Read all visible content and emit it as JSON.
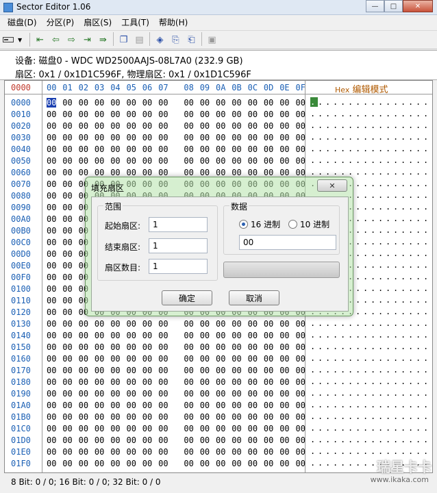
{
  "window": {
    "title": "Sector Editor 1.06",
    "buttons": {
      "minimize": "—",
      "maximize": "□",
      "close": "✕"
    }
  },
  "menu": [
    "磁盘(D)",
    "分区(P)",
    "扇区(S)",
    "工具(T)",
    "帮助(H)"
  ],
  "toolbar": {
    "disk_combo_arrow": "▼",
    "buttons": [
      {
        "name": "first-sector-icon",
        "glyph": "⇤",
        "tone": "green"
      },
      {
        "name": "prev-sector-icon",
        "glyph": "⇦",
        "tone": "green"
      },
      {
        "name": "next-sector-icon",
        "glyph": "⇨",
        "tone": "green"
      },
      {
        "name": "last-sector-icon",
        "glyph": "⇥",
        "tone": "green"
      },
      {
        "name": "goto-sector-icon",
        "glyph": "⇛",
        "tone": "green"
      },
      {
        "name": "copy-icon",
        "glyph": "❐",
        "tone": "blue"
      },
      {
        "name": "paste-icon",
        "glyph": "▤",
        "tone": "gray"
      },
      {
        "name": "fill-icon",
        "glyph": "◈",
        "tone": "blue"
      },
      {
        "name": "export-icon",
        "glyph": "⎘",
        "tone": "blue"
      },
      {
        "name": "import-icon",
        "glyph": "⎗",
        "tone": "blue"
      },
      {
        "name": "save-icon",
        "glyph": "▣",
        "tone": "gray"
      }
    ]
  },
  "info": {
    "device": "设备: 磁盘0 - WDC WD2500AAJS-08L7A0 (232.9 GB)",
    "sector": "扇区: 0x1 / 0x1D1C596F, 物理扇区: 0x1 / 0x1D1C596F"
  },
  "hex": {
    "offset_header": "0000",
    "columns": [
      "00",
      "01",
      "02",
      "03",
      "04",
      "05",
      "06",
      "07",
      "08",
      "09",
      "0A",
      "0B",
      "0C",
      "0D",
      "0E",
      "0F"
    ],
    "mode_prefix": "Hex",
    "mode_label": "编辑模式",
    "rows": [
      "0000",
      "0010",
      "0020",
      "0030",
      "0040",
      "0050",
      "0060",
      "0070",
      "0080",
      "0090",
      "00A0",
      "00B0",
      "00C0",
      "00D0",
      "00E0",
      "00F0",
      "0100",
      "0110",
      "0120",
      "0130",
      "0140",
      "0150",
      "0160",
      "0170",
      "0180",
      "0190",
      "01A0",
      "01B0",
      "01C0",
      "01D0",
      "01E0",
      "01F0"
    ],
    "byte_value": "00",
    "ascii_dot": "."
  },
  "status": "8 Bit: 0 / 0;  16 Bit: 0 / 0;  32 Bit: 0 / 0",
  "watermark": {
    "main": "瑞星卡卡",
    "sub": "www.ikaka.com"
  },
  "dialog": {
    "title": "填充扇区",
    "close_glyph": "✕",
    "range_label": "范围",
    "start_label": "起始扇区:",
    "start_value": "1",
    "end_label": "结束扇区:",
    "end_value": "1",
    "count_label": "扇区数目:",
    "count_value": "1",
    "data_label": "数据",
    "radio_hex": "16 进制",
    "radio_dec": "10 进制",
    "data_value": "00",
    "ok": "确定",
    "cancel": "取消"
  }
}
